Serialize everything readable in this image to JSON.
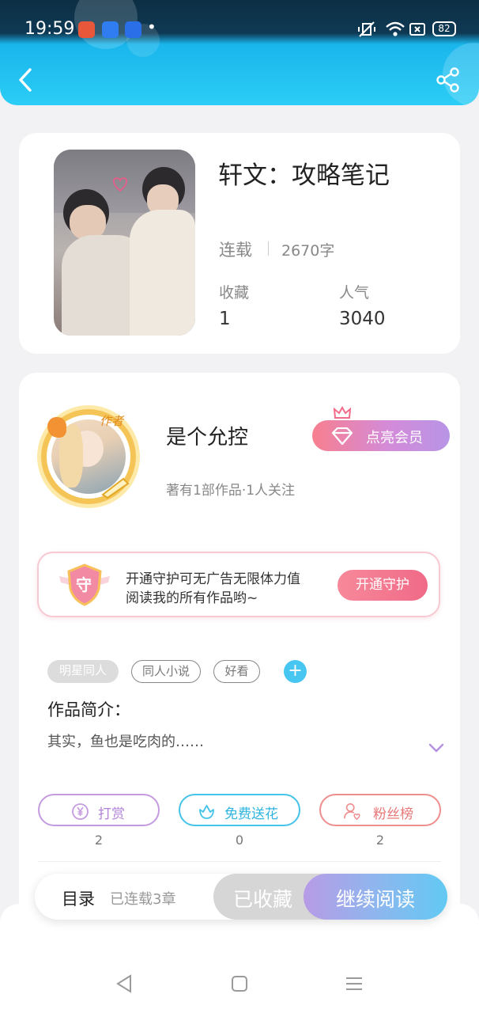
{
  "status_bar": {
    "time": "19:59",
    "dot": "•",
    "battery": "82"
  },
  "book": {
    "title": "轩文：攻略笔记",
    "status": "连载",
    "word_count": "2670字",
    "favorites_label": "收藏",
    "favorites_value": "1",
    "popularity_label": "人气",
    "popularity_value": "3040"
  },
  "author": {
    "badge": "作者",
    "name": "是个允控",
    "stats": "著有1部作品·1人关注",
    "vip_button": "点亮会员"
  },
  "guard": {
    "badge_char": "守",
    "text_line1": "开通守护可无广告无限体力值",
    "text_line2": "阅读我的所有作品哟~",
    "button": "开通守护"
  },
  "tags": [
    "明星同人",
    "同人小说",
    "好看"
  ],
  "intro": {
    "heading": "作品简介：",
    "text": "其实，鱼也是吃肉的……"
  },
  "actions": [
    {
      "label": "打赏",
      "count": "2",
      "color": "#c59be0"
    },
    {
      "label": "免费送花",
      "count": "0",
      "color": "#45c3e8"
    },
    {
      "label": "粉丝榜",
      "count": "2",
      "color": "#ef8e8e"
    }
  ],
  "bottom": {
    "toc": "目录",
    "chapters": "已连载3章",
    "collected": "已收藏",
    "continue": "继续阅读"
  }
}
